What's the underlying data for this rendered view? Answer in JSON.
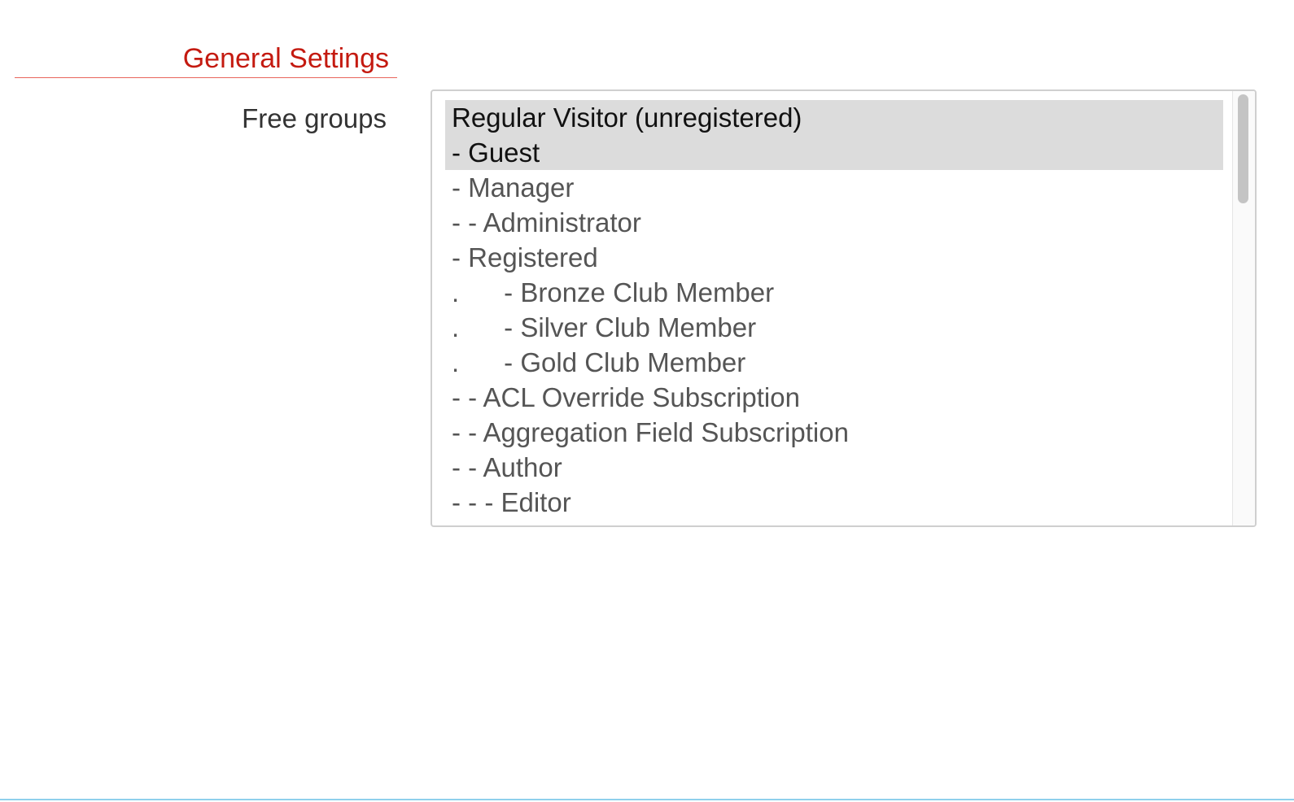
{
  "section": {
    "title": "General Settings"
  },
  "field": {
    "label": "Free groups",
    "options": [
      {
        "label": "Regular Visitor (unregistered)",
        "selected": true
      },
      {
        "label": "- Guest",
        "selected": true
      },
      {
        "label": "- Manager",
        "selected": false
      },
      {
        "label": "- - Administrator",
        "selected": false
      },
      {
        "label": "- Registered",
        "selected": false
      },
      {
        "label": ".      - Bronze Club Member",
        "selected": false
      },
      {
        "label": ".      - Silver Club Member",
        "selected": false
      },
      {
        "label": ".      - Gold Club Member",
        "selected": false
      },
      {
        "label": "- - ACL Override Subscription",
        "selected": false
      },
      {
        "label": "- - Aggregation Field Subscription",
        "selected": false
      },
      {
        "label": "- - Author",
        "selected": false
      },
      {
        "label": "- - - Editor",
        "selected": false
      }
    ]
  },
  "colors": {
    "accent": "#c41a10",
    "selected_bg": "#dcdcdc",
    "bottom_rule": "#8fd0ec"
  }
}
